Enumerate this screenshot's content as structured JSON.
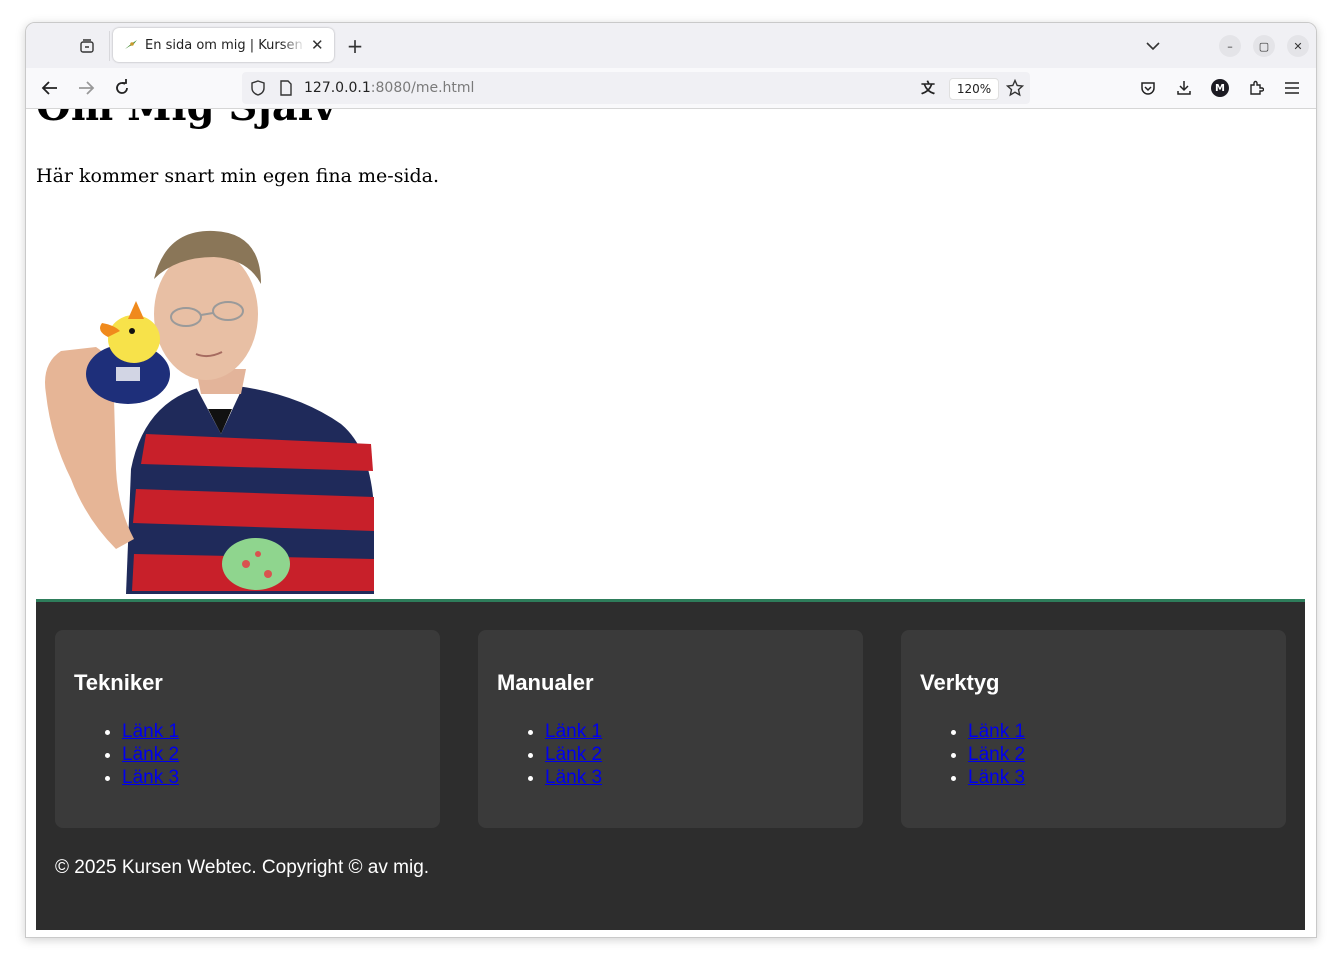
{
  "browser": {
    "tab": {
      "title": "En sida om mig | Kursen webtec",
      "favicon": "hummingbird-favicon"
    },
    "url": {
      "host": "127.0.0.1",
      "path": ":8080/me.html"
    },
    "zoom": "120%",
    "icons": [
      "tab-groups-icon",
      "new-tab-icon",
      "list-all-tabs-icon",
      "minimize-icon",
      "maximize-icon",
      "close-window-icon",
      "back-icon",
      "forward-icon",
      "reload-icon",
      "shield-icon",
      "page-icon",
      "translate-icon",
      "bookmark-star-icon",
      "pocket-icon",
      "download-icon",
      "account-icon",
      "extensions-icon",
      "menu-icon"
    ],
    "account_initial": "M"
  },
  "page": {
    "title": "Om Mig Själv",
    "intro": "Här kommer snart min egen fina me-sida.",
    "photo": "man-holding-rubber-duck-photo"
  },
  "footer": {
    "columns": [
      {
        "heading": "Tekniker",
        "links": [
          "Länk 1",
          "Länk 2",
          "Länk 3"
        ]
      },
      {
        "heading": "Manualer",
        "links": [
          "Länk 1",
          "Länk 2",
          "Länk 3"
        ]
      },
      {
        "heading": "Verktyg",
        "links": [
          "Länk 1",
          "Länk 2",
          "Länk 3"
        ]
      }
    ],
    "copyright": "© 2025 Kursen Webtec. Copyright © av mig."
  },
  "colors": {
    "footer_bg": "#2d2d2d",
    "card_bg": "#3a3a3a",
    "footer_accent": "#2e7d5b",
    "link": "#0000ee"
  }
}
